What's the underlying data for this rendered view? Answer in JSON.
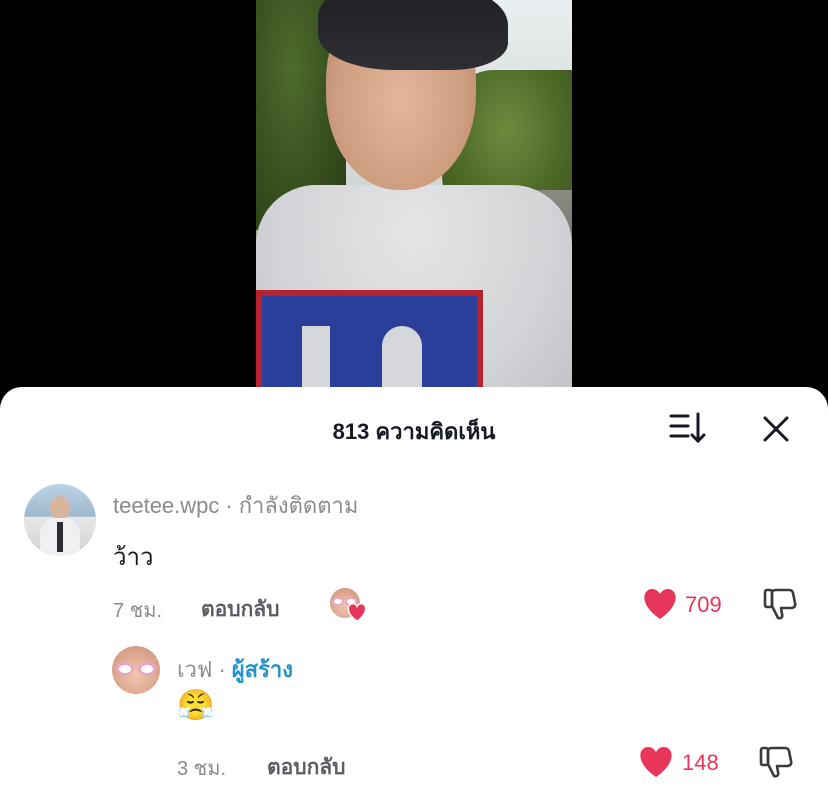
{
  "header": {
    "title": "813 ความคิดเห็น"
  },
  "comments": [
    {
      "username": "teetee.wpc",
      "separator": "·",
      "relation": "กำลังติดตาม",
      "text": "ว้าว",
      "time": "7 ชม.",
      "reply_label": "ตอบกลับ",
      "likes": "709"
    }
  ],
  "reply": {
    "username": "เวฟ",
    "separator": "·",
    "badge": "ผู้สร้าง",
    "emoji": "😤",
    "time": "3 ชม.",
    "reply_label": "ตอบกลับ",
    "likes": "148"
  },
  "icons": {
    "sort": "sort-icon",
    "close": "close-icon",
    "like": "heart-icon",
    "dislike": "thumbs-down-icon"
  },
  "colors": {
    "like": "#e8355a",
    "creator_badge": "#2592c9",
    "secondary_text": "#8a8b91"
  }
}
